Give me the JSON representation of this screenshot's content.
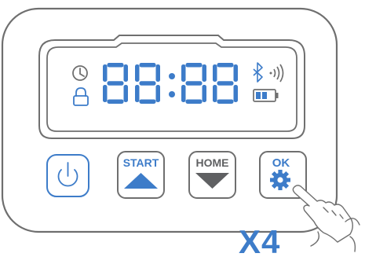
{
  "display": {
    "time": "88:88",
    "icons": [
      "clock-icon",
      "lock-icon",
      "bluetooth-icon",
      "sound-icon",
      "battery-icon"
    ]
  },
  "buttons": {
    "power": {
      "icon": "power-icon"
    },
    "start": {
      "label": "START",
      "icon": "up-triangle-icon"
    },
    "home": {
      "label": "HOME",
      "icon": "down-triangle-icon"
    },
    "ok": {
      "label": "OK",
      "icon": "gear-icon"
    }
  },
  "instruction": {
    "press_count": "X4",
    "gesture": "pointing-hand-icon"
  },
  "colors": {
    "accent": "#3d7cc9",
    "outline": "#6f6f6f",
    "home_gray": "#5f6062",
    "panel_fill": "#ffffff"
  }
}
